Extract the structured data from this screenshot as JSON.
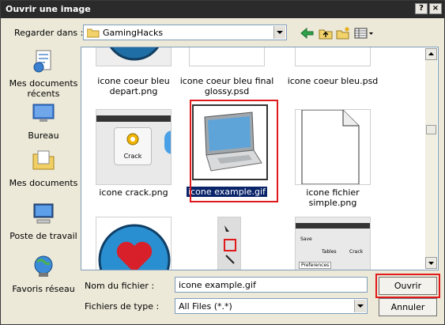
{
  "window": {
    "title": "Ouvrir une image"
  },
  "titlebar_buttons": {
    "help": "?",
    "close": "×"
  },
  "lookin": {
    "label": "Regarder dans :",
    "value": "GamingHacks"
  },
  "places": [
    {
      "label": "Mes documents récents",
      "icon": "recent-documents-icon"
    },
    {
      "label": "Bureau",
      "icon": "desktop-icon"
    },
    {
      "label": "Mes documents",
      "icon": "my-documents-icon"
    },
    {
      "label": "Poste de travail",
      "icon": "my-computer-icon"
    },
    {
      "label": "Favoris réseau",
      "icon": "network-places-icon"
    }
  ],
  "files": [
    {
      "name": "icone coeur bleu depart.png"
    },
    {
      "name": "icone coeur bleu final glossy.psd"
    },
    {
      "name": "icone coeur bleu.psd"
    },
    {
      "name": "icone crack.png",
      "thumb_text": "Crack"
    },
    {
      "name": "icone example.gif",
      "selected": true
    },
    {
      "name": "icone fichier simple.png"
    },
    {
      "name": ""
    },
    {
      "name": ""
    },
    {
      "name": "",
      "thumb_labels": [
        "Save",
        "Tables",
        "Crack",
        "Preferences"
      ]
    }
  ],
  "filename": {
    "label": "Nom du fichier :",
    "value": "icone example.gif"
  },
  "filetype": {
    "label": "Fichiers de type :",
    "value": "All Files (*.*)"
  },
  "buttons": {
    "open": "Ouvrir",
    "cancel": "Annuler"
  },
  "colors": {
    "titlebar": "#2b2b2b",
    "highlight": "#e0191c",
    "selection": "#0a246a",
    "dialog_bg": "#ece9d8"
  }
}
